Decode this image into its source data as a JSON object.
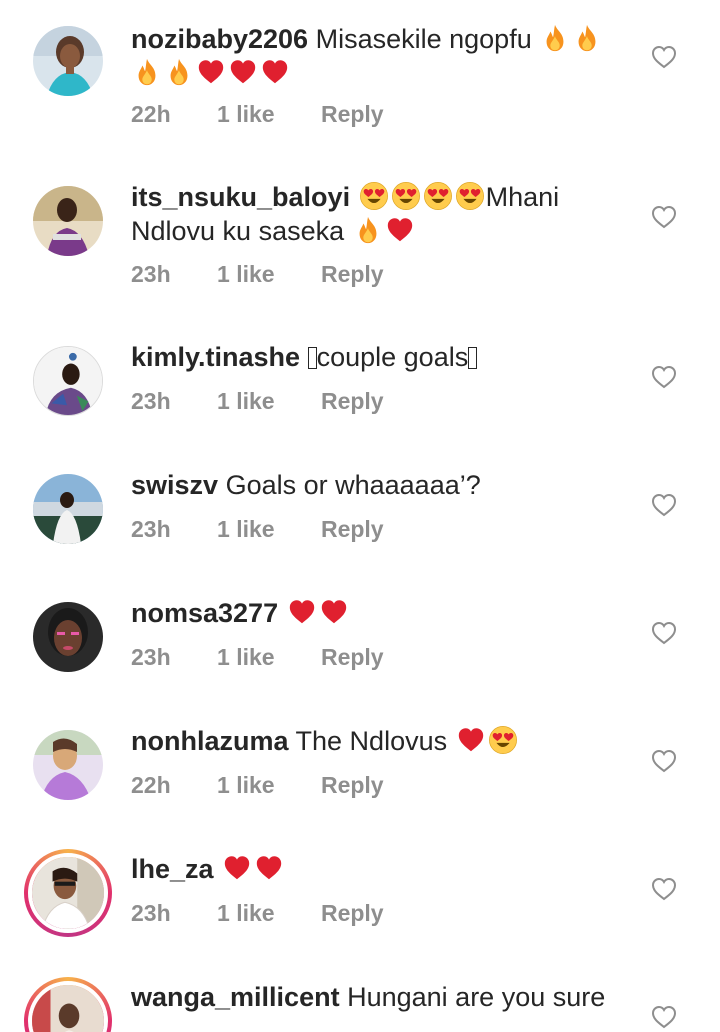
{
  "comments": [
    {
      "username": "nozibaby2206",
      "text": "Misasekile ngopfu",
      "emojis_after": [
        "fire-emoji",
        "fire-emoji",
        "fire-emoji",
        "fire-emoji",
        "heart-emoji",
        "heart-emoji",
        "heart-emoji"
      ],
      "time": "22h",
      "likes": "1 like",
      "reply": "Reply"
    },
    {
      "username": "its_nsuku_baloyi",
      "text_before": "",
      "emojis_mid": [
        "heart-eyes-emoji",
        "heart-eyes-emoji",
        "heart-eyes-emoji",
        "heart-eyes-emoji"
      ],
      "text": "Mhani Ndlovu ku saseka",
      "emojis_after": [
        "fire-emoji",
        "heart-emoji"
      ],
      "time": "23h",
      "likes": "1 like",
      "reply": "Reply"
    },
    {
      "username": "kimly.tinashe",
      "text": "couple goals",
      "time": "23h",
      "likes": "1 like",
      "reply": "Reply"
    },
    {
      "username": "swiszv",
      "text": "Goals or whaaaaaa’?",
      "time": "23h",
      "likes": "1 like",
      "reply": "Reply"
    },
    {
      "username": "nomsa3277",
      "text": "",
      "emojis_after": [
        "heart-emoji",
        "heart-emoji"
      ],
      "time": "23h",
      "likes": "1 like",
      "reply": "Reply"
    },
    {
      "username": "nonhlazuma",
      "text": "The Ndlovus",
      "emojis_after": [
        "heart-emoji",
        "heart-eyes-emoji"
      ],
      "time": "22h",
      "likes": "1 like",
      "reply": "Reply"
    },
    {
      "username": "lhe_za",
      "text": "",
      "emojis_after": [
        "heart-emoji",
        "heart-emoji"
      ],
      "time": "23h",
      "likes": "1 like",
      "reply": "Reply"
    },
    {
      "username": "wanga_millicent",
      "text": "Hungani are you sure",
      "time": "",
      "likes": "",
      "reply": ""
    }
  ],
  "colors": {
    "username": "#262626",
    "meta": "#8e8e8e",
    "heart_outline": "#8e8e8e",
    "red_heart": "#e0202f",
    "story_ring": "#e1306c"
  }
}
